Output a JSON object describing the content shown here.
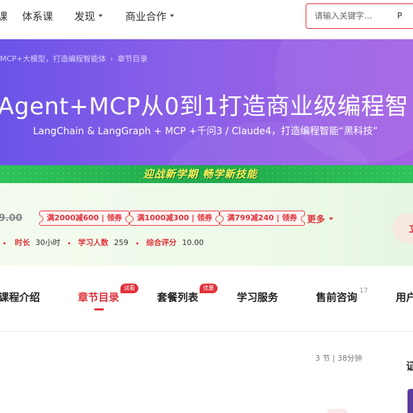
{
  "topnav": {
    "items": [
      {
        "label": "课",
        "has_caret": false
      },
      {
        "label": "体系课",
        "has_caret": false
      },
      {
        "label": "发现",
        "has_caret": true
      },
      {
        "label": "商业合作",
        "has_caret": true
      }
    ],
    "search": {
      "placeholder": "请输入关键字...",
      "suffix": "P"
    }
  },
  "banner": {
    "breadcrumb": [
      "MCP+大模型，打造编程智能体",
      "章节目录"
    ],
    "title": "Agent+MCP从0到1打造商业级编程智",
    "subtitle": "LangChain & LangGraph + MCP +千问3 / Claude4，打造编程智能“黑科技”"
  },
  "promo": {
    "text": "迎战新学期 畅学新技能"
  },
  "pricing": {
    "old_price": "9.00",
    "coupons": [
      "满2000减600 | 领券",
      "满1000减300 | 领券",
      "满799减240 | 领券"
    ],
    "more_label": "更多",
    "buy_label": "立",
    "meta": [
      {
        "label": "时长",
        "value": "30小时"
      },
      {
        "label": "学习人数",
        "value": "259"
      },
      {
        "label": "综合评分",
        "value": "10.00"
      }
    ]
  },
  "tabs": {
    "items": [
      {
        "label": "课程介绍"
      },
      {
        "label": "章节目录",
        "badge": "试看",
        "active": true
      },
      {
        "label": "套餐列表",
        "badge": "优惠"
      },
      {
        "label": "学习服务"
      },
      {
        "label": "售前咨询",
        "count": "17"
      },
      {
        "label": "用户"
      }
    ]
  },
  "content": {
    "chapter_meta": "3 节 | 38分钟",
    "side_title": "证"
  },
  "colors": {
    "accent": "#e0323a",
    "banner_start": "#6b53e8",
    "banner_end": "#a461e4",
    "promo_green": "#1fa94a"
  }
}
